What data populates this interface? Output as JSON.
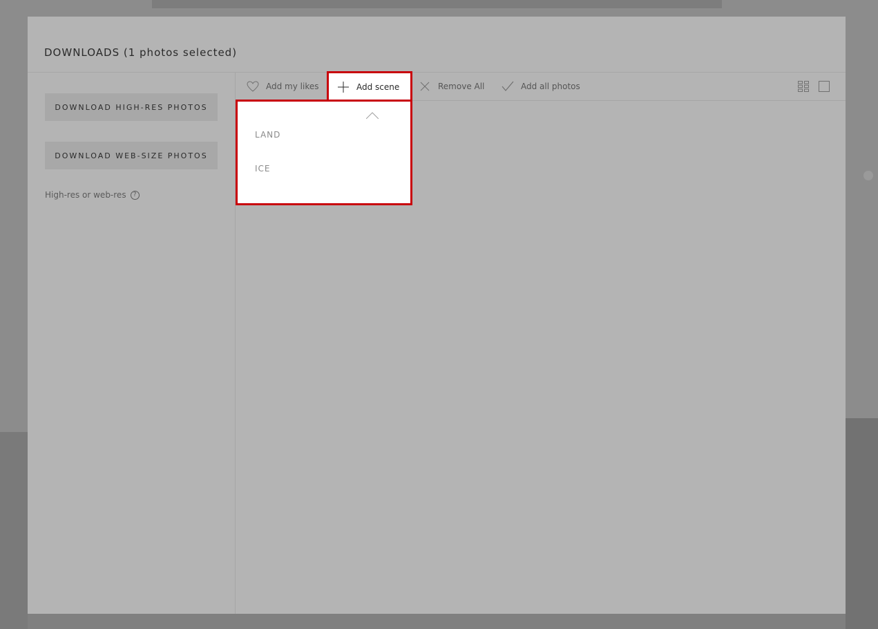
{
  "modal": {
    "title": "DOWNLOADS (1 photos selected)"
  },
  "sidebar": {
    "download_highres_label": "DOWNLOAD HIGH-RES PHOTOS",
    "download_websize_label": "DOWNLOAD WEB-SIZE PHOTOS",
    "res_help_label": "High-res or web-res",
    "help_icon_glyph": "?"
  },
  "toolbar": {
    "add_likes_label": "Add my likes",
    "add_scene_label": "Add scene",
    "remove_all_label": "Remove All",
    "add_all_photos_label": "Add all photos"
  },
  "scene_dropdown": {
    "options": [
      "LAND",
      "ICE"
    ]
  },
  "colors": {
    "highlight": "#c8000a",
    "modal_bg": "#b4b4b4",
    "button_bg": "#a8a8a8"
  },
  "icons": {
    "likes": "heart-icon",
    "scene": "plus-icon",
    "remove": "close-icon",
    "add_all": "check-icon",
    "grid_view": "grid-icon",
    "single_view": "square-icon"
  }
}
